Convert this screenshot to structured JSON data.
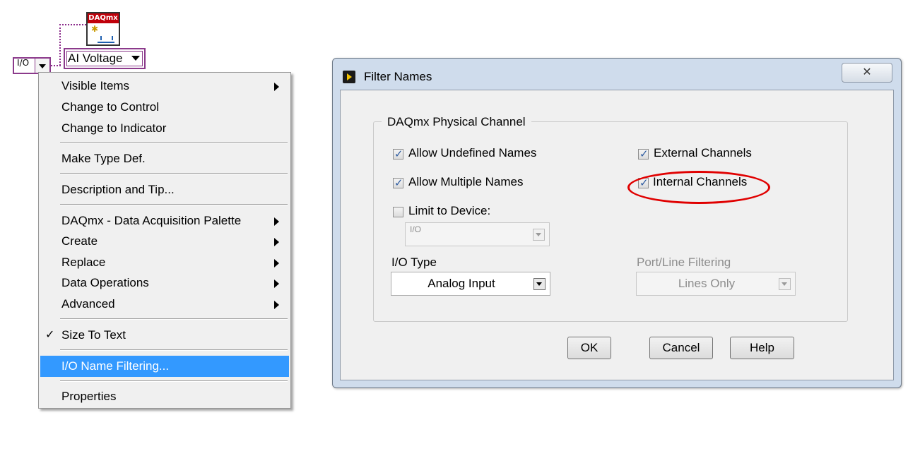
{
  "diagram": {
    "io_constant_glyph": "I/O",
    "daqmx_icon_label": "DAQmx",
    "ai_selector_label": "AI Voltage"
  },
  "menu": {
    "items": [
      {
        "label": "Visible Items",
        "submenu": true
      },
      {
        "label": "Change to Control"
      },
      {
        "label": "Change to Indicator"
      },
      {
        "label": "Make Type Def."
      },
      {
        "label": "Description and Tip..."
      },
      {
        "label": "DAQmx - Data Acquisition Palette",
        "submenu": true
      },
      {
        "label": "Create",
        "submenu": true
      },
      {
        "label": "Replace",
        "submenu": true
      },
      {
        "label": "Data Operations",
        "submenu": true
      },
      {
        "label": "Advanced",
        "submenu": true
      },
      {
        "label": "Size To Text",
        "checked": true
      },
      {
        "label": "I/O Name Filtering...",
        "highlighted": true
      },
      {
        "label": "Properties"
      }
    ],
    "check_glyph": "✓"
  },
  "dialog": {
    "title": "Filter Names",
    "close_glyph": "✕",
    "group_title": "DAQmx Physical Channel",
    "checkboxes": {
      "allow_undefined": {
        "label": "Allow Undefined Names",
        "checked": true
      },
      "allow_multiple": {
        "label": "Allow Multiple Names",
        "checked": true
      },
      "limit_device": {
        "label": "Limit to Device:",
        "checked": false
      },
      "external": {
        "label": "External Channels",
        "checked": true
      },
      "internal": {
        "label": "Internal Channels",
        "checked": true
      }
    },
    "device_combo_value": "I/O",
    "io_type": {
      "label": "I/O Type",
      "value": "Analog Input"
    },
    "port_line": {
      "label": "Port/Line Filtering",
      "value": "Lines Only"
    },
    "buttons": {
      "ok": "OK",
      "cancel": "Cancel",
      "help": "Help"
    }
  },
  "annotation": {
    "color": "#e00000",
    "target": "Internal Channels"
  },
  "colors": {
    "wire": "#8a2a8a",
    "menu_highlight": "#3399ff",
    "dialog_frame": "#cfdcec",
    "checkbox_mark": "#2c5aa0"
  }
}
